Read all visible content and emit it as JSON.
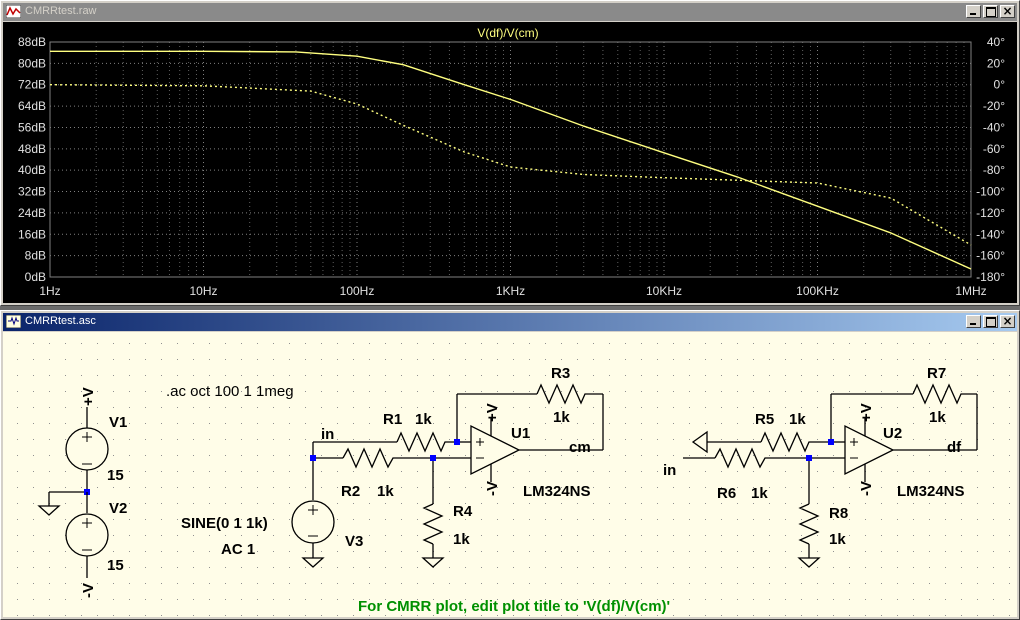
{
  "plot_window": {
    "title": "CMRRtest.raw",
    "trace_title": "V(df)/V(cm)",
    "left_ticks": [
      "88dB",
      "80dB",
      "72dB",
      "64dB",
      "56dB",
      "48dB",
      "40dB",
      "32dB",
      "24dB",
      "16dB",
      "8dB",
      "0dB"
    ],
    "right_ticks": [
      "40°",
      "20°",
      "0°",
      "-20°",
      "-40°",
      "-60°",
      "-80°",
      "-100°",
      "-120°",
      "-140°",
      "-160°",
      "-180°"
    ],
    "x_ticks": [
      "1Hz",
      "10Hz",
      "100Hz",
      "1KHz",
      "10KHz",
      "100KHz",
      "1MHz"
    ],
    "trace_color": "#ffff80"
  },
  "chart_data": {
    "type": "line",
    "title": "V(df)/V(cm)",
    "x_scale": "log",
    "xlim": [
      "1Hz",
      "1MHz"
    ],
    "ylim_left": [
      0,
      88
    ],
    "ylim_right": [
      -180,
      40
    ],
    "grid": true,
    "series": [
      {
        "name": "magnitude",
        "style": "solid",
        "x_hz": [
          1,
          10,
          40,
          100,
          200,
          500,
          1000,
          3000,
          10000,
          30000,
          100000,
          300000,
          1000000
        ],
        "y_db": [
          84.5,
          84.5,
          84.3,
          82.7,
          79.5,
          72,
          66.5,
          56.5,
          46.5,
          37.5,
          26.5,
          16.5,
          3
        ]
      },
      {
        "name": "phase",
        "style": "dashed",
        "x_hz": [
          1,
          10,
          50,
          100,
          200,
          500,
          1000,
          3000,
          10000,
          100000,
          300000,
          1000000
        ],
        "y_deg": [
          0,
          -1,
          -6,
          -18,
          -38,
          -63,
          -77,
          -84,
          -87,
          -92,
          -106,
          -150
        ]
      }
    ]
  },
  "schematic_window": {
    "title": "CMRRtest.asc",
    "directive": ".ac oct 100 1 1meg",
    "note": "For CMRR plot, edit plot title to 'V(df)/V(cm)'",
    "note_color": "#009000",
    "labels": {
      "vplus_top": "+V",
      "v1": "V1",
      "v1_val": "15",
      "v2": "V2",
      "v2_val": "15",
      "vminus_bottom": "-V",
      "in1": "in",
      "r1": "R1",
      "r1_val": "1k",
      "r2": "R2",
      "r2_val": "1k",
      "r3": "R3",
      "r3_val": "1k",
      "r4": "R4",
      "r4_val": "1k",
      "u1": "U1",
      "u1_model": "LM324NS",
      "u1_vplus": "+V",
      "u1_vminus": "-V",
      "cm": "cm",
      "sine": "SINE(0 1 1k)",
      "ac": "AC 1",
      "v3": "V3",
      "r5": "R5",
      "r5_val": "1k",
      "r6": "R6",
      "r6_val": "1k",
      "r7": "R7",
      "r7_val": "1k",
      "r8": "R8",
      "r8_val": "1k",
      "u2": "U2",
      "u2_model": "LM324NS",
      "u2_vplus": "+V",
      "u2_vminus": "-V",
      "in2": "in",
      "df": "df"
    }
  }
}
